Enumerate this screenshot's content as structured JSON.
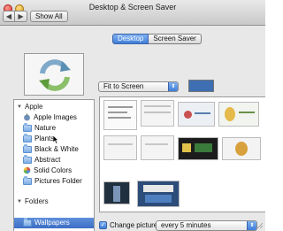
{
  "window": {
    "title": "Desktop & Screen Saver",
    "back_glyph": "◀",
    "forward_glyph": "▶",
    "show_all_label": "Show All"
  },
  "tabs": [
    {
      "label": "Desktop",
      "active": true
    },
    {
      "label": "Screen Saver",
      "active": false
    }
  ],
  "fit_popup": {
    "value": "Fit to Screen",
    "arrows_glyph": "⬍"
  },
  "desktop_color": "#3d6fb2",
  "sidebar": {
    "groups": [
      {
        "label": "Apple",
        "items": [
          "Apple Images",
          "Nature",
          "Plants",
          "Black & White",
          "Abstract",
          "Solid Colors",
          "Pictures Folder"
        ]
      },
      {
        "label": "Folders",
        "items": [
          "Wallpapers"
        ]
      }
    ],
    "selected_item": "Wallpapers",
    "add_glyph": "+",
    "remove_glyph": "−"
  },
  "change_picture": {
    "checked": true,
    "check_glyph": "✓",
    "label": "Change picture:",
    "interval": "every 5 minutes",
    "arrows_glyph": "⬍"
  },
  "icons": {
    "preview": "refresh-arrows-icon",
    "folder": "folder-icon",
    "apple": "apple-icon",
    "disclosure": "disclosure-triangle-icon"
  },
  "colors": {
    "accent": "#3f7fd8",
    "selection": "#3b6ec4",
    "window_bg": "#e8e8e8"
  }
}
